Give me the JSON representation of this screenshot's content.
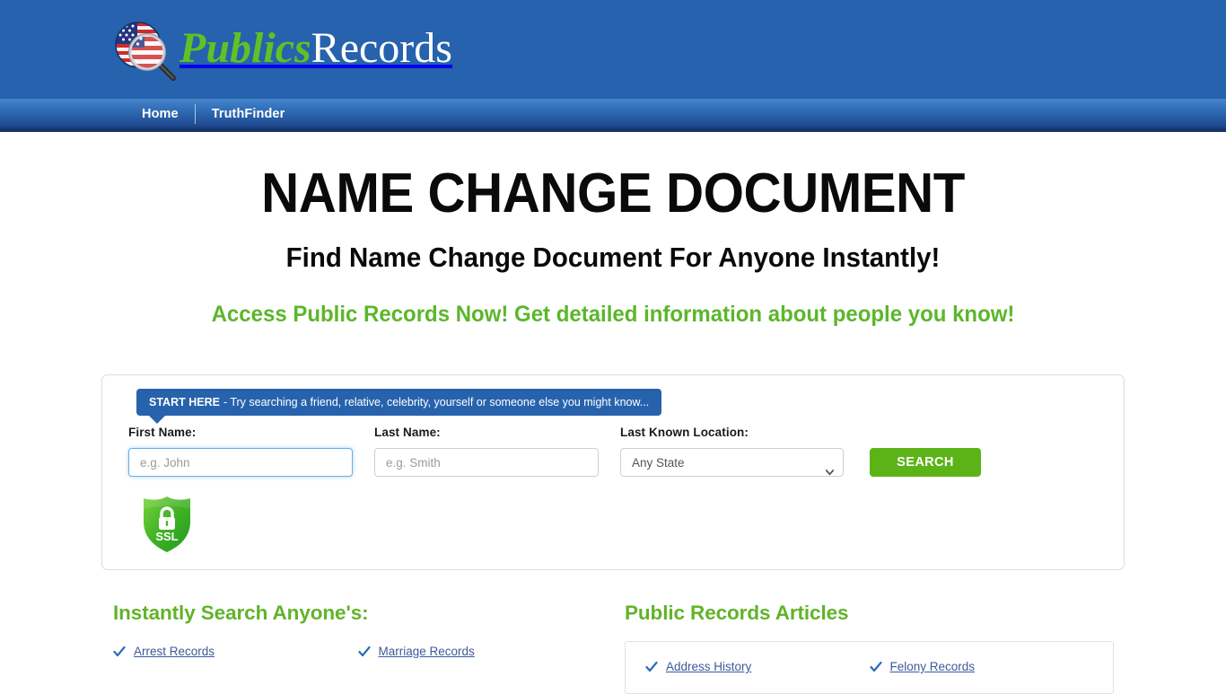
{
  "brand": {
    "name_part1": "Publics",
    "name_part2": "Records",
    "logo_icon": "flag-magnifier-icon",
    "header_bg": "#2662ad",
    "green": "#62c026"
  },
  "nav": {
    "items": [
      {
        "label": "Home",
        "name": "nav-item-home"
      },
      {
        "label": "TruthFinder",
        "name": "nav-item-truthfinder"
      }
    ]
  },
  "hero": {
    "title": "NAME CHANGE DOCUMENT",
    "subtitle": "Find Name Change Document For Anyone Instantly!",
    "tagline": "Access Public Records Now! Get detailed information about people you know!",
    "tagline_color": "#5cb62b"
  },
  "search": {
    "banner_bold": "START HERE",
    "banner_rest": "- Try searching a friend, relative, celebrity, yourself or someone else you might know...",
    "first_name": {
      "label": "First Name:",
      "placeholder": "e.g. John",
      "value": "",
      "focused": true
    },
    "last_name": {
      "label": "Last Name:",
      "placeholder": "e.g. Smith",
      "value": ""
    },
    "location": {
      "label": "Last Known Location:",
      "selected": "Any State",
      "options": [
        "Any State"
      ]
    },
    "submit_label": "SEARCH",
    "submit_color": "#5cb317",
    "ssl_badge_text": "SSL",
    "ssl_badge_icon": "padlock-shield-icon"
  },
  "instantly_search": {
    "title": "Instantly Search Anyone's:",
    "links": [
      "Arrest Records",
      "Marriage Records"
    ]
  },
  "articles": {
    "title": "Public Records Articles",
    "links": [
      "Address History",
      "Felony Records"
    ]
  }
}
